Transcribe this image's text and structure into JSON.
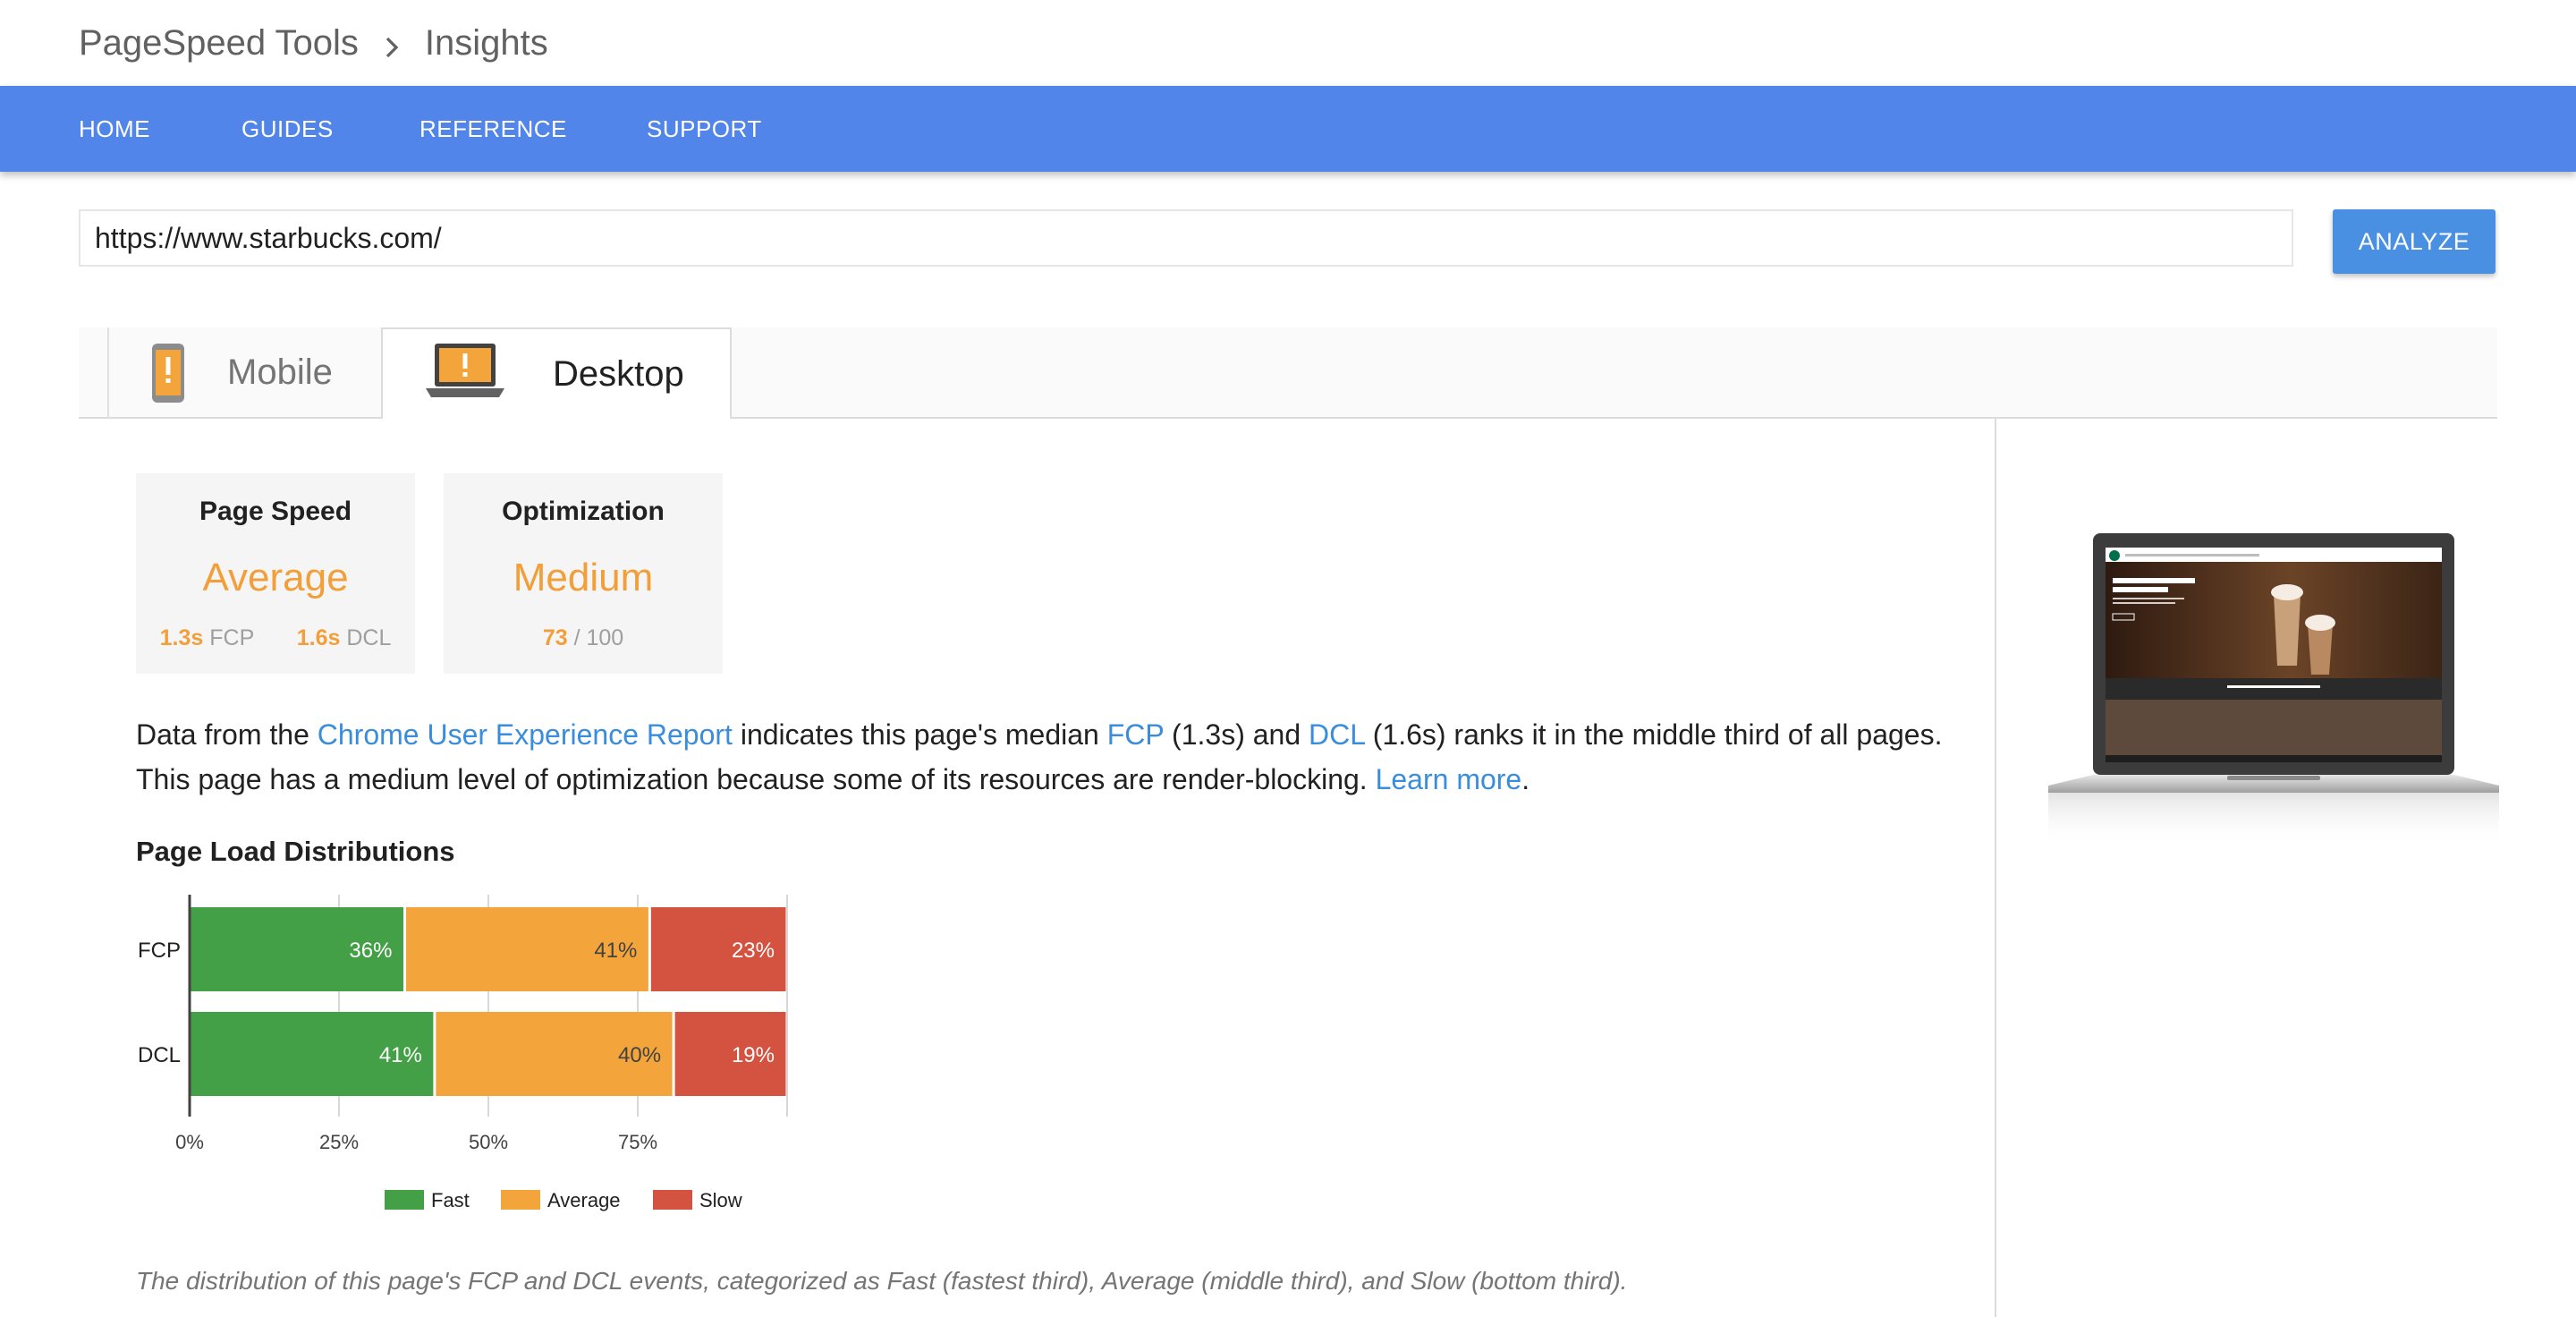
{
  "header": {
    "breadcrumb": [
      "PageSpeed Tools",
      "Insights"
    ],
    "nav": [
      "HOME",
      "GUIDES",
      "REFERENCE",
      "SUPPORT"
    ]
  },
  "search": {
    "url": "https://www.starbucks.com/",
    "button": "ANALYZE"
  },
  "tabs": [
    {
      "label": "Mobile",
      "icon": "mobile-phone-warning-icon",
      "selected": false
    },
    {
      "label": "Desktop",
      "icon": "laptop-warning-icon",
      "selected": true
    }
  ],
  "cards": {
    "speed": {
      "title": "Page Speed",
      "value": "Average",
      "fcp_value": "1.3s",
      "fcp_label": "FCP",
      "dcl_value": "1.6s",
      "dcl_label": "DCL"
    },
    "optimization": {
      "title": "Optimization",
      "value": "Medium",
      "score": "73",
      "max": "/ 100"
    }
  },
  "description": {
    "line1_a": "Data from the ",
    "link_report": "Chrome User Experience Report",
    "line1_b": " indicates this page's median ",
    "link_fcp": "FCP",
    "line1_c": " (1.3s) and ",
    "link_dcl": "DCL",
    "line1_d": " (1.6s) ranks it in the middle third of all pages.",
    "line2_a": "This page has a medium level of optimization because some of its resources are render-blocking. ",
    "link_learn": "Learn more",
    "line2_b": "."
  },
  "distribution_heading": "Page Load Distributions",
  "caption": "The distribution of this page's FCP and DCL events, categorized as Fast (fastest third), Average (middle third), and Slow (bottom third).",
  "colors": {
    "fast": "#43a047",
    "average": "#f3a53b",
    "slow": "#d35340",
    "accent": "#f29f3a",
    "nav": "#5185ea",
    "link": "#3a8ddb"
  },
  "chart_data": {
    "type": "bar",
    "orientation": "horizontal-stacked",
    "categories": [
      "FCP",
      "DCL"
    ],
    "series": [
      {
        "name": "Fast",
        "values": [
          36,
          41
        ],
        "labels": [
          "36%",
          "41%"
        ]
      },
      {
        "name": "Average",
        "values": [
          41,
          40
        ],
        "labels": [
          "41%",
          "40%"
        ]
      },
      {
        "name": "Slow",
        "values": [
          23,
          19
        ],
        "labels": [
          "23%",
          "19%"
        ]
      }
    ],
    "xticks": [
      "0%",
      "25%",
      "50%",
      "75%"
    ],
    "xlim": [
      0,
      100
    ],
    "grid": true,
    "legend_position": "bottom"
  }
}
